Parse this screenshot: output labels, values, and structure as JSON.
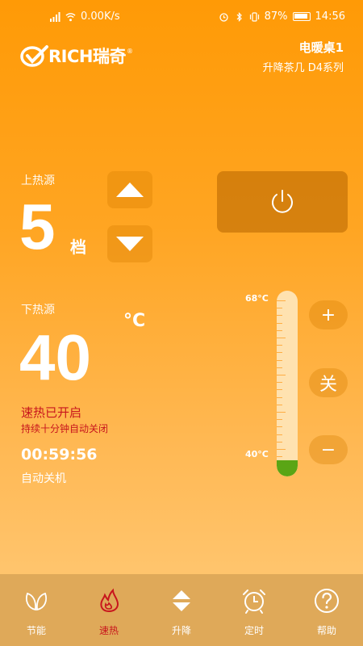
{
  "statusbar": {
    "network_speed": "0.00K/s",
    "battery": "87%",
    "time": "14:56"
  },
  "logo": {
    "text": "RICH瑞奇",
    "reg": "®"
  },
  "device": {
    "name": "电暖桌1",
    "series": "升降茶几 D4系列"
  },
  "upper_heat": {
    "label": "上热源",
    "value": "5",
    "unit": "档"
  },
  "lower_heat": {
    "label": "下热源",
    "value": "40",
    "unit": "°C"
  },
  "fast_heat": {
    "status": "速热已开启",
    "note": "持续十分钟自动关闭"
  },
  "auto_off": {
    "countdown": "00:59:56",
    "label": "自动关机"
  },
  "thermometer": {
    "max_label": "68°C",
    "min_label": "40°C",
    "level": 0.0
  },
  "controls": {
    "plus": "+",
    "off": "关",
    "minus": "−"
  },
  "tabs": [
    {
      "label": "节能",
      "icon": "leaf-icon",
      "active": false
    },
    {
      "label": "速热",
      "icon": "flame-icon",
      "active": true
    },
    {
      "label": "升降",
      "icon": "up-down-icon",
      "active": false
    },
    {
      "label": "定时",
      "icon": "alarm-clock-icon",
      "active": false
    },
    {
      "label": "帮助",
      "icon": "help-icon",
      "active": false
    }
  ],
  "colors": {
    "accent_red": "#c8161d",
    "thermo_fill": "#5aa515",
    "tabbar": "#dfa959"
  }
}
